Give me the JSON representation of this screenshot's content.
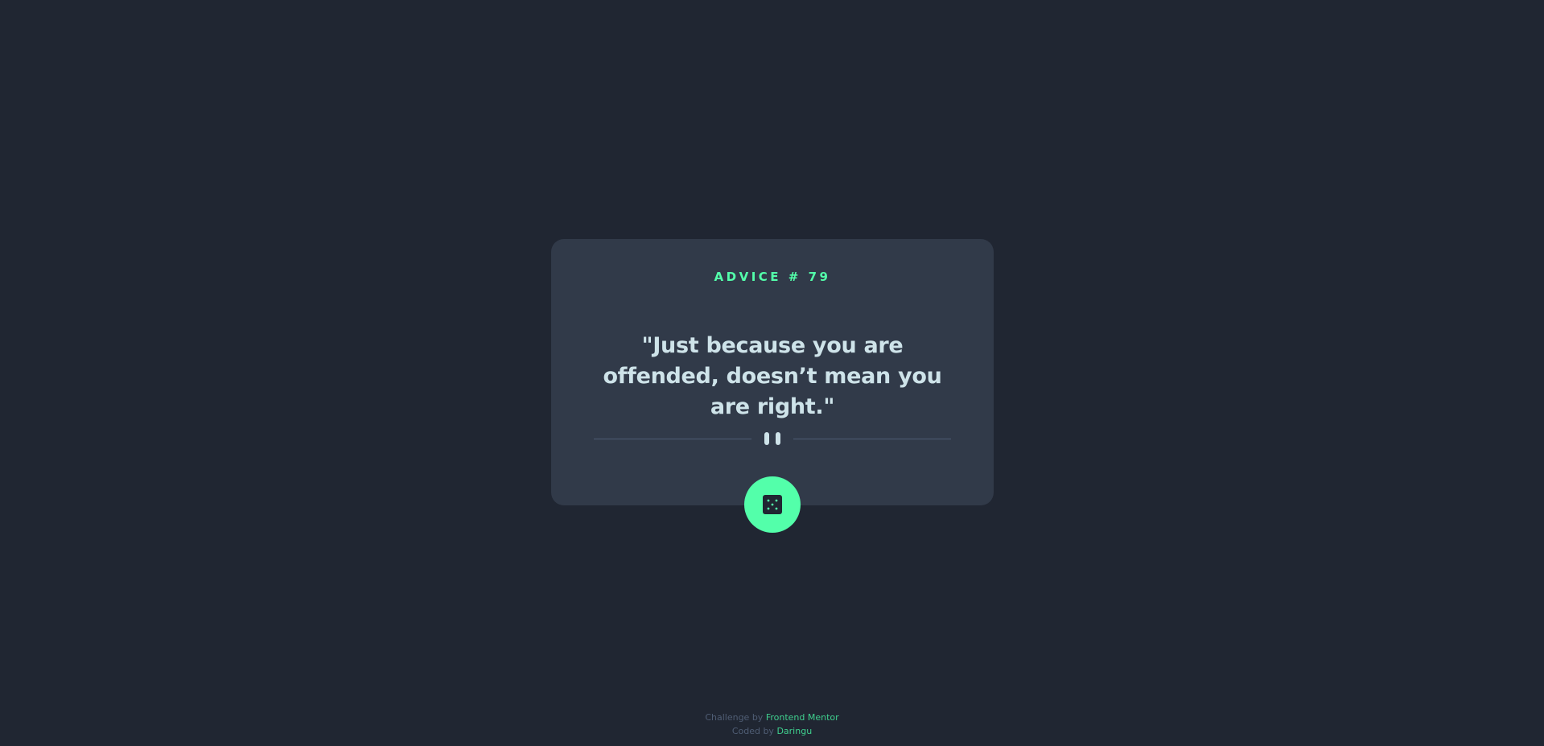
{
  "card": {
    "label": "ADVICE # 79",
    "quote": "\"Just because you are offended, doesn’t mean you are right.\""
  },
  "dice_button": {
    "icon": "dice-icon"
  },
  "footer": {
    "challenge_prefix": "Challenge by ",
    "challenge_link": "Frontend Mentor",
    "coded_prefix": "Coded by ",
    "coded_link": "Daringu"
  },
  "colors": {
    "background": "#202632",
    "card": "#313a49",
    "accent": "#53ffaa",
    "text": "#cee3e9",
    "muted": "#4f5d74"
  }
}
